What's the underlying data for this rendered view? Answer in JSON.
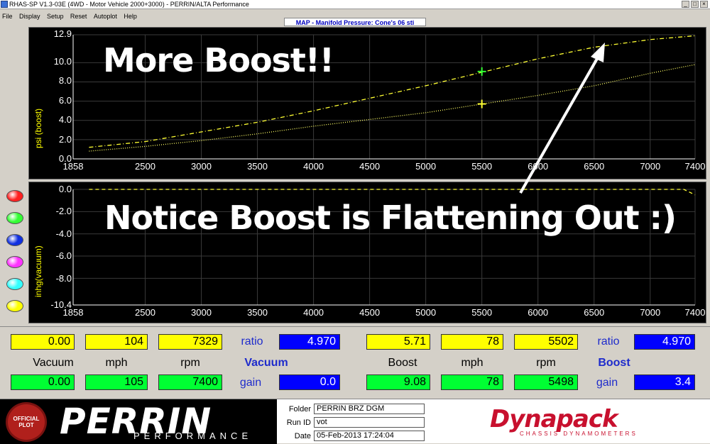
{
  "window": {
    "title": "RHAS-SP V1.3-03E  (4WD - Motor Vehicle 2000+3000) - PERRIN/ALTA Performance",
    "controls": [
      "_",
      "□",
      "×"
    ]
  },
  "menu": [
    "File",
    "Display",
    "Setup",
    "Reset",
    "Autoplot",
    "Help"
  ],
  "plot_title": "MAP - Manifold Pressure: Cone's 06 sti",
  "overlay": {
    "top_text": "More Boost!!",
    "bottom_text": "Notice Boost is Flattening Out  :)"
  },
  "leds": [
    {
      "name": "red",
      "color": "#ff2020"
    },
    {
      "name": "green",
      "color": "#33ff33"
    },
    {
      "name": "blue",
      "color": "#1030e0"
    },
    {
      "name": "magenta",
      "color": "#ff33ff"
    },
    {
      "name": "cyan",
      "color": "#33ffff"
    },
    {
      "name": "yellow",
      "color": "#ffff00"
    }
  ],
  "chart_data": [
    {
      "type": "line",
      "ylabel": "psi (boost)",
      "xlim": [
        1858,
        7400
      ],
      "ylim": [
        0.0,
        12.9
      ],
      "x_ticks": [
        "1858",
        "2500",
        "3000",
        "3500",
        "4000",
        "4500",
        "5000",
        "5500",
        "6000",
        "6500",
        "7000",
        "7400"
      ],
      "y_ticks": [
        "12.9",
        "10.0",
        "8.0",
        "6.0",
        "4.0",
        "2.0",
        "0.0"
      ],
      "grid": true,
      "series": [
        {
          "style": "dash-dot",
          "color": "#ffff33",
          "x": [
            2000,
            2500,
            3000,
            3500,
            4000,
            4500,
            5000,
            5500,
            6000,
            6500,
            7000,
            7400
          ],
          "y": [
            1.2,
            1.8,
            2.8,
            3.8,
            5.0,
            6.3,
            7.6,
            9.0,
            10.4,
            11.6,
            12.4,
            12.8
          ]
        },
        {
          "style": "dotted",
          "color": "#ffff66",
          "x": [
            2000,
            2500,
            3000,
            3500,
            4000,
            4500,
            5000,
            5500,
            6000,
            6500,
            7000,
            7400
          ],
          "y": [
            0.8,
            1.3,
            1.9,
            2.6,
            3.4,
            4.1,
            4.8,
            5.7,
            6.6,
            7.6,
            8.9,
            9.8
          ]
        }
      ],
      "cursors": [
        {
          "x": 5500,
          "y": 9.08,
          "color": "#33ff33"
        },
        {
          "x": 5500,
          "y": 5.71,
          "color": "#ffff33"
        }
      ]
    },
    {
      "type": "line",
      "ylabel": "inhg(vacuum)",
      "xlim": [
        1858,
        7400
      ],
      "ylim": [
        -10.4,
        0.0
      ],
      "x_ticks": [
        "1858",
        "2500",
        "3000",
        "3500",
        "4000",
        "4500",
        "5000",
        "5500",
        "6000",
        "6500",
        "7000",
        "7400"
      ],
      "y_ticks": [
        "0.0",
        "-2.0",
        "-4.0",
        "-6.0",
        "-8.0",
        "-10.4"
      ],
      "grid": true,
      "series": [
        {
          "style": "dash",
          "color": "#ffff33",
          "x": [
            2000,
            7300,
            7400
          ],
          "y": [
            0.0,
            0.0,
            -0.5
          ]
        }
      ]
    }
  ],
  "readouts": {
    "left": {
      "row1": [
        "0.00",
        "104",
        "7329"
      ],
      "row2": [
        "0.00",
        "105",
        "7400"
      ],
      "labels": [
        "Vacuum",
        "mph",
        "rpm"
      ],
      "ratio_label": "ratio",
      "ratio_value": "4.970",
      "gain_label": "gain",
      "gain_value": "0.0",
      "title": "Vacuum"
    },
    "right": {
      "row1": [
        "5.71",
        "78",
        "5502"
      ],
      "row2": [
        "9.08",
        "78",
        "5498"
      ],
      "labels": [
        "Boost",
        "mph",
        "rpm"
      ],
      "ratio_label": "ratio",
      "ratio_value": "4.970",
      "gain_label": "gain",
      "gain_value": "3.4",
      "title": "Boost"
    }
  },
  "footer": {
    "seal_text": "OFFICIAL PLOT",
    "logo": "PERRIN",
    "logo_sub": "PERFORMANCE",
    "folder_label": "Folder",
    "folder_value": "PERRIN BRZ DGM",
    "runid_label": "Run ID",
    "runid_value": "vot",
    "date_label": "Date",
    "date_value": "05-Feb-2013  17:24:04",
    "dyna_logo": "Dynapack",
    "dyna_sub": "CHASSIS DYNAMOMETERS"
  }
}
